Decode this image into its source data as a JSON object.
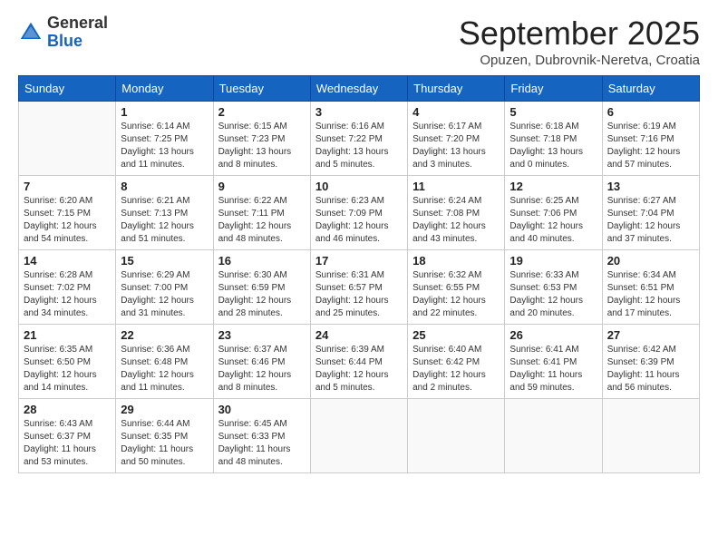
{
  "header": {
    "logo_general": "General",
    "logo_blue": "Blue",
    "month_title": "September 2025",
    "location": "Opuzen, Dubrovnik-Neretva, Croatia"
  },
  "days_of_week": [
    "Sunday",
    "Monday",
    "Tuesday",
    "Wednesday",
    "Thursday",
    "Friday",
    "Saturday"
  ],
  "weeks": [
    [
      {
        "day": "",
        "info": ""
      },
      {
        "day": "1",
        "info": "Sunrise: 6:14 AM\nSunset: 7:25 PM\nDaylight: 13 hours\nand 11 minutes."
      },
      {
        "day": "2",
        "info": "Sunrise: 6:15 AM\nSunset: 7:23 PM\nDaylight: 13 hours\nand 8 minutes."
      },
      {
        "day": "3",
        "info": "Sunrise: 6:16 AM\nSunset: 7:22 PM\nDaylight: 13 hours\nand 5 minutes."
      },
      {
        "day": "4",
        "info": "Sunrise: 6:17 AM\nSunset: 7:20 PM\nDaylight: 13 hours\nand 3 minutes."
      },
      {
        "day": "5",
        "info": "Sunrise: 6:18 AM\nSunset: 7:18 PM\nDaylight: 13 hours\nand 0 minutes."
      },
      {
        "day": "6",
        "info": "Sunrise: 6:19 AM\nSunset: 7:16 PM\nDaylight: 12 hours\nand 57 minutes."
      }
    ],
    [
      {
        "day": "7",
        "info": "Sunrise: 6:20 AM\nSunset: 7:15 PM\nDaylight: 12 hours\nand 54 minutes."
      },
      {
        "day": "8",
        "info": "Sunrise: 6:21 AM\nSunset: 7:13 PM\nDaylight: 12 hours\nand 51 minutes."
      },
      {
        "day": "9",
        "info": "Sunrise: 6:22 AM\nSunset: 7:11 PM\nDaylight: 12 hours\nand 48 minutes."
      },
      {
        "day": "10",
        "info": "Sunrise: 6:23 AM\nSunset: 7:09 PM\nDaylight: 12 hours\nand 46 minutes."
      },
      {
        "day": "11",
        "info": "Sunrise: 6:24 AM\nSunset: 7:08 PM\nDaylight: 12 hours\nand 43 minutes."
      },
      {
        "day": "12",
        "info": "Sunrise: 6:25 AM\nSunset: 7:06 PM\nDaylight: 12 hours\nand 40 minutes."
      },
      {
        "day": "13",
        "info": "Sunrise: 6:27 AM\nSunset: 7:04 PM\nDaylight: 12 hours\nand 37 minutes."
      }
    ],
    [
      {
        "day": "14",
        "info": "Sunrise: 6:28 AM\nSunset: 7:02 PM\nDaylight: 12 hours\nand 34 minutes."
      },
      {
        "day": "15",
        "info": "Sunrise: 6:29 AM\nSunset: 7:00 PM\nDaylight: 12 hours\nand 31 minutes."
      },
      {
        "day": "16",
        "info": "Sunrise: 6:30 AM\nSunset: 6:59 PM\nDaylight: 12 hours\nand 28 minutes."
      },
      {
        "day": "17",
        "info": "Sunrise: 6:31 AM\nSunset: 6:57 PM\nDaylight: 12 hours\nand 25 minutes."
      },
      {
        "day": "18",
        "info": "Sunrise: 6:32 AM\nSunset: 6:55 PM\nDaylight: 12 hours\nand 22 minutes."
      },
      {
        "day": "19",
        "info": "Sunrise: 6:33 AM\nSunset: 6:53 PM\nDaylight: 12 hours\nand 20 minutes."
      },
      {
        "day": "20",
        "info": "Sunrise: 6:34 AM\nSunset: 6:51 PM\nDaylight: 12 hours\nand 17 minutes."
      }
    ],
    [
      {
        "day": "21",
        "info": "Sunrise: 6:35 AM\nSunset: 6:50 PM\nDaylight: 12 hours\nand 14 minutes."
      },
      {
        "day": "22",
        "info": "Sunrise: 6:36 AM\nSunset: 6:48 PM\nDaylight: 12 hours\nand 11 minutes."
      },
      {
        "day": "23",
        "info": "Sunrise: 6:37 AM\nSunset: 6:46 PM\nDaylight: 12 hours\nand 8 minutes."
      },
      {
        "day": "24",
        "info": "Sunrise: 6:39 AM\nSunset: 6:44 PM\nDaylight: 12 hours\nand 5 minutes."
      },
      {
        "day": "25",
        "info": "Sunrise: 6:40 AM\nSunset: 6:42 PM\nDaylight: 12 hours\nand 2 minutes."
      },
      {
        "day": "26",
        "info": "Sunrise: 6:41 AM\nSunset: 6:41 PM\nDaylight: 11 hours\nand 59 minutes."
      },
      {
        "day": "27",
        "info": "Sunrise: 6:42 AM\nSunset: 6:39 PM\nDaylight: 11 hours\nand 56 minutes."
      }
    ],
    [
      {
        "day": "28",
        "info": "Sunrise: 6:43 AM\nSunset: 6:37 PM\nDaylight: 11 hours\nand 53 minutes."
      },
      {
        "day": "29",
        "info": "Sunrise: 6:44 AM\nSunset: 6:35 PM\nDaylight: 11 hours\nand 50 minutes."
      },
      {
        "day": "30",
        "info": "Sunrise: 6:45 AM\nSunset: 6:33 PM\nDaylight: 11 hours\nand 48 minutes."
      },
      {
        "day": "",
        "info": ""
      },
      {
        "day": "",
        "info": ""
      },
      {
        "day": "",
        "info": ""
      },
      {
        "day": "",
        "info": ""
      }
    ]
  ]
}
